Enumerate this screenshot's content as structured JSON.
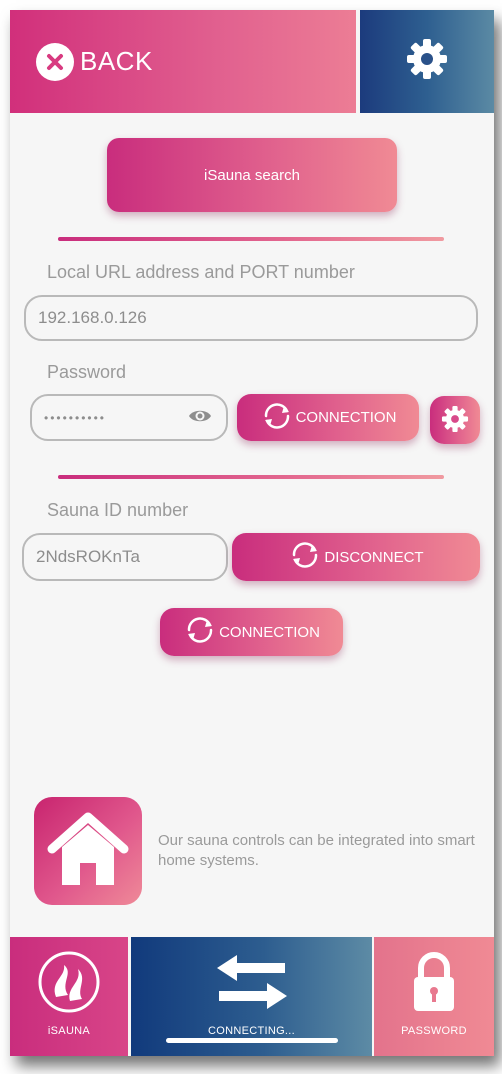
{
  "header": {
    "back_label": "BACK",
    "back_icon": "close-circle-icon",
    "settings_icon": "gear-icon"
  },
  "search": {
    "button_label": "iSauna search"
  },
  "local": {
    "url_label": "Local URL address and PORT number",
    "url_value": "192.168.0.126",
    "password_label": "Password",
    "password_value": "••••••••••",
    "password_icon": "eye-icon",
    "connect_label": "CONNECTION",
    "settings_icon": "gear-icon"
  },
  "remote": {
    "id_label": "Sauna ID number",
    "id_value": "2NdsROKnTa",
    "disconnect_label": "DISCONNECT",
    "connect_label": "CONNECTION"
  },
  "smart_home": {
    "icon": "house-icon",
    "text": "Our sauna controls can be integrated into smart home systems."
  },
  "tabbar": {
    "isauna_label": "iSAUNA",
    "connecting_label": "CONNECTING...",
    "password_label": "PASSWORD"
  },
  "colors": {
    "accent_pink": "#d12f7b",
    "accent_blue": "#1c3b7d",
    "background": "#f6f6f6"
  }
}
